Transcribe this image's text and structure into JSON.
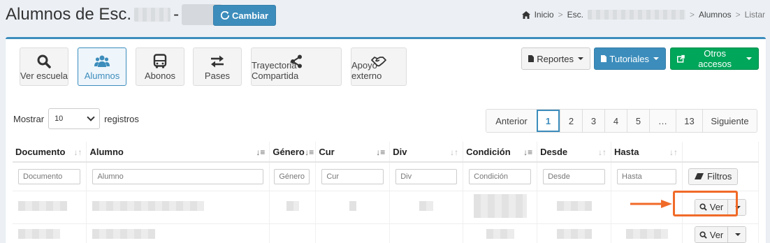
{
  "header": {
    "title_prefix": "Alumnos de Esc.",
    "title_sep": "-",
    "cambiar_label": "Cambiar"
  },
  "breadcrumb": {
    "home": "Inicio",
    "esc": "Esc.",
    "alumnos": "Alumnos",
    "listar": "Listar",
    "sep": ">"
  },
  "tiles": [
    {
      "label": "Ver escuela",
      "icon": "search-icon"
    },
    {
      "label": "Alumnos",
      "icon": "users-icon"
    },
    {
      "label": "Abonos",
      "icon": "bus-icon"
    },
    {
      "label": "Pases",
      "icon": "exchange-icon"
    },
    {
      "label": "Trayectoria Compartida",
      "icon": "share-icon"
    },
    {
      "label": "Apoyo externo",
      "icon": "handshake-icon"
    }
  ],
  "dropdowns": {
    "reportes": "Reportes",
    "tutoriales": "Tutoriales",
    "otros": "Otros accesos"
  },
  "length": {
    "prefix": "Mostrar",
    "value": "10",
    "suffix": "registros"
  },
  "pagination": {
    "prev": "Anterior",
    "pages": [
      "1",
      "2",
      "3",
      "4",
      "5",
      "…",
      "13"
    ],
    "current": "1",
    "next": "Siguiente"
  },
  "table": {
    "columns": [
      "Documento",
      "Alumno",
      "Género",
      "Cur",
      "Div",
      "Condición",
      "Desde",
      "Hasta"
    ],
    "filters": [
      "Documento",
      "Alumno",
      "Género",
      "Cur",
      "Div",
      "Condición",
      "Desde",
      "Hasta"
    ],
    "filtros_label": "Filtros",
    "ver_label": "Ver"
  },
  "colors": {
    "primary": "#3c8dbc",
    "success": "#00a65a",
    "highlight": "#f06a28"
  }
}
